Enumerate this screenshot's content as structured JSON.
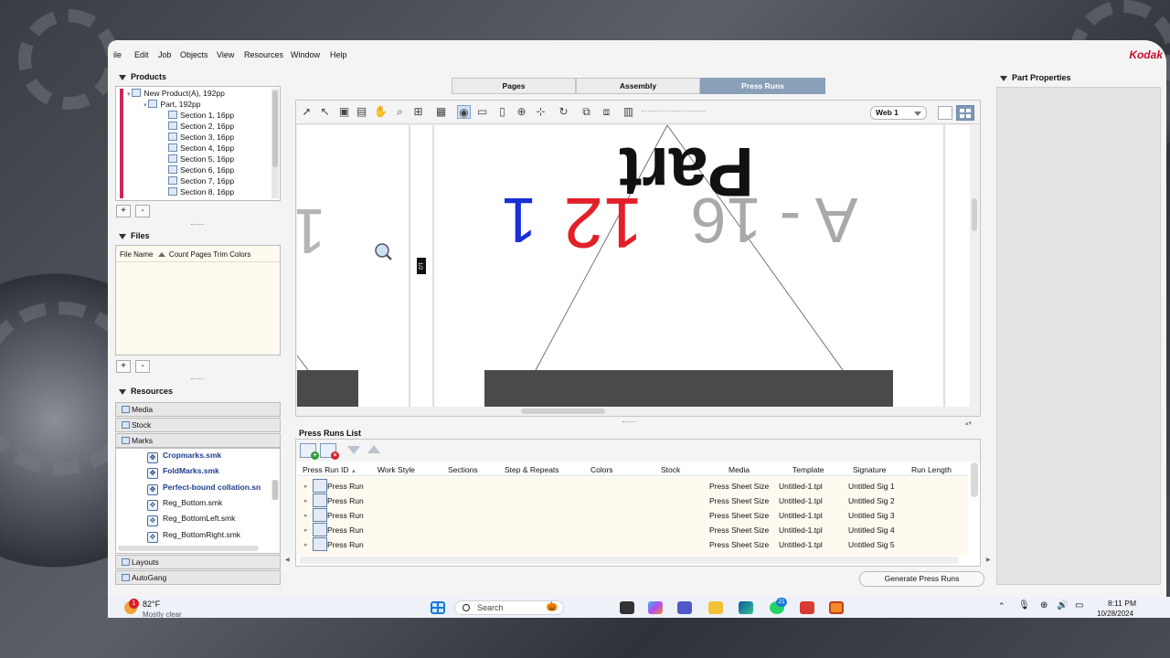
{
  "app": {
    "menu": [
      "ile",
      "Edit",
      "Job",
      "Objects",
      "View",
      "Resources",
      "Window",
      "Help"
    ],
    "brand": "Kodak"
  },
  "products": {
    "title": "Products",
    "tree": [
      {
        "label": "New Product(A), 192pp",
        "level": 0
      },
      {
        "label": "Part, 192pp",
        "level": 1
      },
      {
        "label": "Section 1, 16pp",
        "level": 2
      },
      {
        "label": "Section 2, 16pp",
        "level": 2
      },
      {
        "label": "Section 3, 16pp",
        "level": 2
      },
      {
        "label": "Section 4, 16pp",
        "level": 2
      },
      {
        "label": "Section 5, 16pp",
        "level": 2
      },
      {
        "label": "Section 6, 16pp",
        "level": 2
      },
      {
        "label": "Section 7, 16pp",
        "level": 2
      },
      {
        "label": "Section 8, 16pp",
        "level": 2
      }
    ],
    "add": "+",
    "remove": "-"
  },
  "files": {
    "title": "Files",
    "columns": [
      "File Name",
      "Count",
      "Pages",
      "Trim",
      "Colors"
    ],
    "add": "+",
    "remove": "-"
  },
  "resources": {
    "title": "Resources",
    "groups": [
      "Media",
      "Stock",
      "Marks",
      "Layouts",
      "AutoGang"
    ],
    "marks": [
      {
        "name": "Cropmarks.smk",
        "bold": true
      },
      {
        "name": "FoldMarks.smk",
        "bold": true
      },
      {
        "name": "Perfect-bound collation.sn",
        "bold": true
      },
      {
        "name": "Reg_Bottom.smk",
        "bold": false
      },
      {
        "name": "Reg_BottomLeft.smk",
        "bold": false
      },
      {
        "name": "Reg_BottomRight.smk",
        "bold": false
      }
    ]
  },
  "tabs": [
    {
      "label": "Pages",
      "active": false
    },
    {
      "label": "Assembly",
      "active": false
    },
    {
      "label": "Press Runs",
      "active": true
    }
  ],
  "editor": {
    "web_select": "Web  1",
    "canvas": {
      "part_text": "Part",
      "mark_left": "1",
      "mark_blue": "1",
      "mark_red": "12",
      "mark_gray": "A - 16",
      "marker_tag": "1/2"
    }
  },
  "press_runs": {
    "title": "Press Runs List",
    "columns": [
      "Press Run ID",
      "Work Style",
      "Sections",
      "Step & Repeats",
      "Colors",
      "Stock",
      "Media",
      "Template",
      "Signature",
      "Run Length"
    ],
    "rows": [
      {
        "id": "Press Run",
        "media": "Press Sheet Size",
        "template": "Untitled-1.tpl",
        "signature": "Untitled Sig 1"
      },
      {
        "id": "Press Run",
        "media": "Press Sheet Size",
        "template": "Untitled-1.tpl",
        "signature": "Untitled Sig 2"
      },
      {
        "id": "Press Run",
        "media": "Press Sheet Size",
        "template": "Untitled-1.tpl",
        "signature": "Untitled Sig 3"
      },
      {
        "id": "Press Run",
        "media": "Press Sheet Size",
        "template": "Untitled-1.tpl",
        "signature": "Untitled Sig 4"
      },
      {
        "id": "Press Run",
        "media": "Press Sheet Size",
        "template": "Untitled-1.tpl",
        "signature": "Untitled Sig 5"
      }
    ],
    "generate_button": "Generate Press Runs"
  },
  "part_properties": {
    "title": "Part Properties"
  },
  "taskbar": {
    "weather_temp": "82°F",
    "weather_desc": "Mostly clear",
    "weather_badge": "1",
    "search_placeholder": "Search",
    "whatsapp_badge": "21",
    "time": "8:11 PM",
    "date": "10/28/2024"
  },
  "colors": {
    "accent_tab": "#8aa0b8",
    "product_bar": "#c8285c",
    "kodak_red": "#c8102e",
    "mark_red": "#e3202a",
    "mark_blue": "#1a2fd6"
  }
}
